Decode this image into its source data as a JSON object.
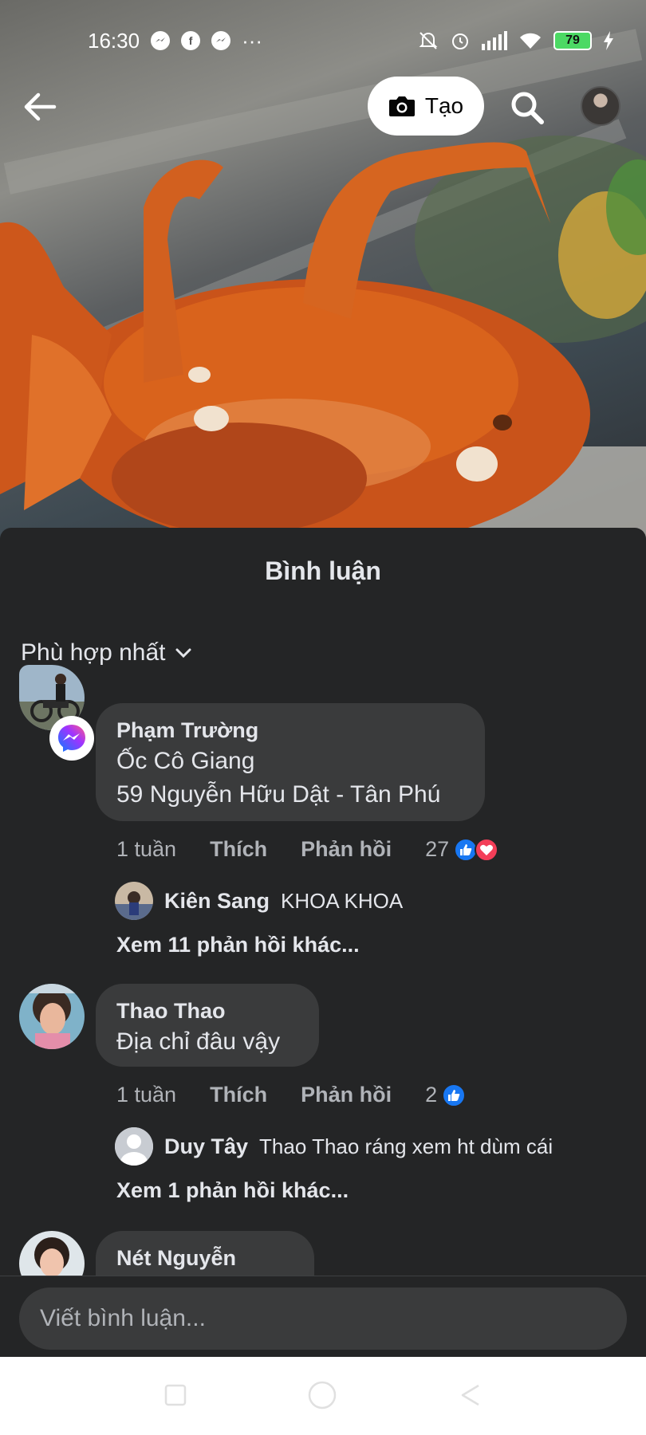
{
  "status_bar": {
    "time": "16:30",
    "more": "···",
    "battery": "79",
    "icons": [
      "messenger-icon",
      "facebook-icon",
      "messenger-icon",
      "mute-icon",
      "alarm-icon",
      "signal-icon",
      "wifi-icon",
      "battery-icon",
      "charging-icon"
    ]
  },
  "top_bar": {
    "create_label": "Tạo",
    "icons": [
      "back-arrow-icon",
      "camera-icon",
      "search-icon"
    ]
  },
  "comments_sheet": {
    "title": "Bình luận",
    "sort_label": "Phù hợp nhất",
    "comments": [
      {
        "author": "Phạm Trường",
        "lines": [
          "Ốc Cô Giang",
          "59 Nguyễn Hữu Dật - Tân Phú"
        ],
        "time": "1 tuần",
        "like": "Thích",
        "reply": "Phản hồi",
        "reactions": "27",
        "reaction_types": [
          "like",
          "love"
        ],
        "reply_preview": {
          "author": "Kiên Sang",
          "text": "KHOA KHOA"
        },
        "more_replies": "Xem 11 phản hồi khác..."
      },
      {
        "author": "Thao Thao",
        "lines": [
          "Địa chỉ đâu vậy"
        ],
        "time": "1 tuần",
        "like": "Thích",
        "reply": "Phản hồi",
        "reactions": "2",
        "reaction_types": [
          "like"
        ],
        "reply_preview": {
          "author": "Duy Tây",
          "text": "Thao Thao ráng xem ht dùm cái"
        },
        "more_replies": "Xem 1 phản hồi khác..."
      },
      {
        "author": "Nét Nguyễn"
      }
    ]
  },
  "composer": {
    "placeholder": "Viết bình luận..."
  },
  "colors": {
    "sheet_bg": "#242526",
    "bubble_bg": "#3a3b3c",
    "text_primary": "#e4e6eb",
    "text_secondary": "#b0b3b8",
    "like_blue": "#1877f2",
    "love_red": "#f33e58",
    "video_crab_orange": "#d9631c"
  }
}
